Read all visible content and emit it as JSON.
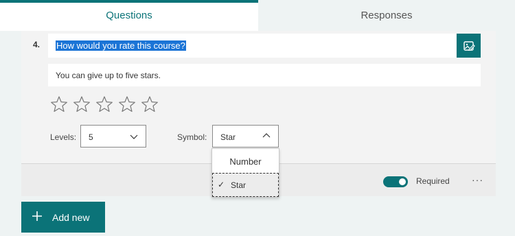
{
  "tabs": {
    "questions": "Questions",
    "responses": "Responses"
  },
  "question": {
    "number": "4.",
    "title": "How would you rate this course?",
    "subtitle": "You can give up to five stars.",
    "rating_icons": [
      "star-outline-icon",
      "star-outline-icon",
      "star-outline-icon",
      "star-outline-icon",
      "star-outline-icon"
    ]
  },
  "settings": {
    "levels_label": "Levels:",
    "levels_value": "5",
    "symbol_label": "Symbol:",
    "symbol_value": "Star",
    "symbol_options": [
      "Number",
      "Star"
    ],
    "symbol_selected": "Star"
  },
  "footer": {
    "required_label": "Required",
    "required_on": true,
    "more_label": "···"
  },
  "add_new": {
    "label": "Add new"
  },
  "colors": {
    "accent": "#0b7378",
    "selection": "#1b74d6",
    "card_bg": "#f3f3f3",
    "page_bg": "#eef3f3"
  }
}
